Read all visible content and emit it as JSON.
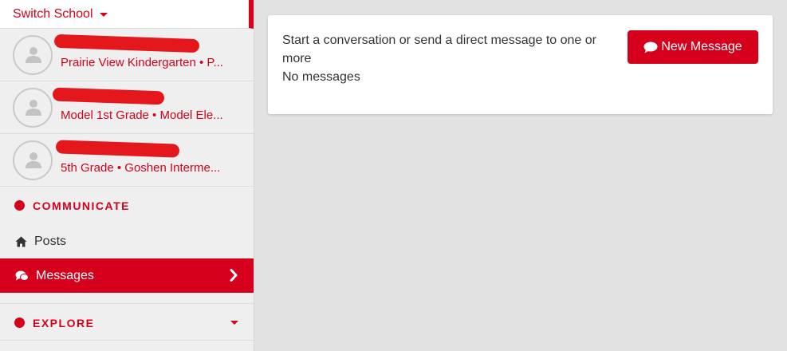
{
  "sidebar": {
    "switch_school": "Switch School",
    "children": [
      {
        "subtitle": "Prairie View Kindergarten • P..."
      },
      {
        "subtitle": "Model 1st Grade • Model Ele..."
      },
      {
        "subtitle": "5th Grade • Goshen Interme..."
      }
    ],
    "communicate_heading": "COMMUNICATE",
    "posts_label": "Posts",
    "messages_label": "Messages",
    "explore_heading": "EXPLORE"
  },
  "main": {
    "prompt_text": "Start a conversation or send a direct message to one or more",
    "empty_text": "No messages",
    "new_message_label": "New Message"
  },
  "colors": {
    "brand_red": "#d6001c",
    "background": "#e2e2e2"
  },
  "icons": {
    "switch_caret": "caret-down-icon",
    "avatar": "user-icon",
    "posts": "home-icon",
    "messages": "chat-bubbles-icon",
    "messages_chevron": "chevron-right-icon",
    "explore_caret": "caret-down-icon",
    "new_message": "chat-bubble-icon"
  }
}
